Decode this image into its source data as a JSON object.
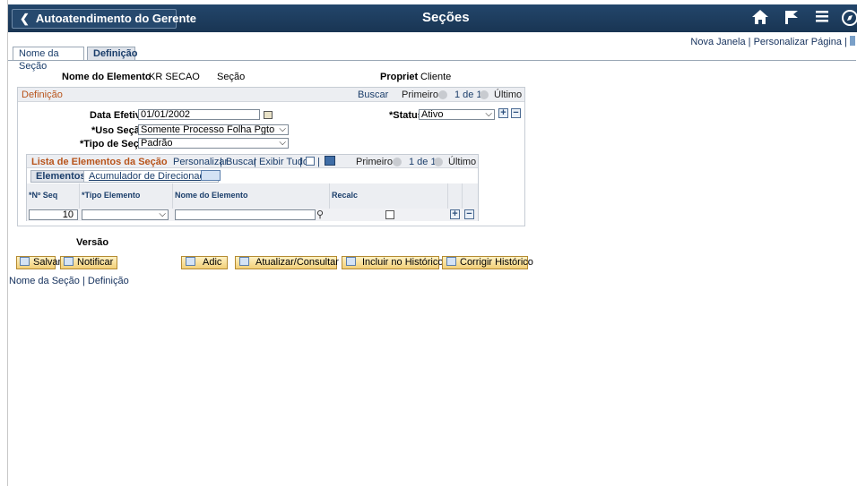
{
  "header": {
    "back_label": "Autoatendimento do Gerente",
    "title": "Seções",
    "icons": [
      "home-icon",
      "flag-icon",
      "menu-icon",
      "navbar-icon"
    ]
  },
  "top_links": {
    "new_window": "Nova Janela",
    "separator": "|",
    "personalize": "Personalizar Página",
    "trailing": "|"
  },
  "tabs": [
    {
      "label": "Nome da Seção",
      "active": false
    },
    {
      "label": "Definição",
      "active": true
    }
  ],
  "info": {
    "element_name_label": "Nome do Elemento",
    "element_name_value": "KR SECAO",
    "element_type": "Seção",
    "owner_label": "Propriet",
    "owner_value": "Cliente"
  },
  "definition": {
    "title": "Definição",
    "search": "Buscar",
    "first": "Primeiro",
    "count": "1 de 1",
    "last": "Último",
    "effdt_label": "Data Efetiva",
    "effdt_value": "01/01/2002",
    "status_label": "*Status",
    "status_value": "Ativo",
    "usage_label": "*Uso Seção",
    "usage_value": "Somente Processo Folha Pgto",
    "type_label": "*Tipo de Seção",
    "type_value": "Padrão"
  },
  "elements_list": {
    "title": "Lista de Elementos da Seção",
    "personalize": "Personalizar",
    "sep1": "|",
    "search": "Buscar",
    "sep2": "|",
    "view_all": "Exibir Tudo",
    "sep3": "|",
    "sep4": "|",
    "first": "Primeiro",
    "count": "1 de 1",
    "last": "Último",
    "subtabs": [
      {
        "label": "Elementos",
        "active": true
      },
      {
        "label": "Acumulador de Direcionador",
        "active": false
      }
    ],
    "columns": [
      "*Nº Seq",
      "*Tipo Elemento",
      "Nome do Elemento",
      "Recalc"
    ],
    "row": {
      "seq": "10",
      "element_type": "",
      "element_name": "",
      "recalc": false
    }
  },
  "version_label": "Versão",
  "buttons": {
    "save": "Salvar",
    "notify": "Notificar",
    "add": "Adic",
    "update": "Atualizar/Consultar",
    "include_history": "Incluir no Histórico",
    "correct_history": "Corrigir Histórico"
  },
  "footer_links": {
    "section_name": "Nome da Seção",
    "separator": "|",
    "definition": "Definição"
  },
  "colors": {
    "header_bg": "#1e3d5e",
    "orange_title": "#b8541b",
    "link": "#1b3e6b",
    "button_bg": "#f5d887"
  }
}
